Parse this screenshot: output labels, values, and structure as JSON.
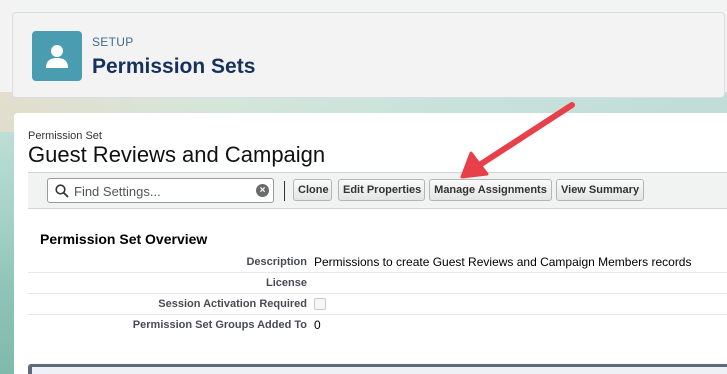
{
  "header": {
    "breadcrumb": "SETUP",
    "title": "Permission Sets",
    "icon": "user-icon"
  },
  "permission_set": {
    "label": "Permission Set",
    "name": "Guest Reviews and Campaign"
  },
  "toolbar": {
    "search_placeholder": "Find Settings...",
    "clone_label": "Clone",
    "edit_label": "Edit Properties",
    "manage_label": "Manage Assignments",
    "view_label": "View Summary"
  },
  "overview": {
    "title": "Permission Set Overview",
    "rows": [
      {
        "label": "Description",
        "value": "Permissions to create Guest Reviews and Campaign Members records"
      },
      {
        "label": "License",
        "value": ""
      },
      {
        "label": "Session Activation Required",
        "value": ""
      },
      {
        "label": "Permission Set Groups Added To",
        "value": "0"
      }
    ],
    "session_activation_checked": false
  },
  "colors": {
    "icon_bg": "#4a9cb0",
    "title": "#16325c",
    "annotation_arrow": "#e8404a"
  }
}
